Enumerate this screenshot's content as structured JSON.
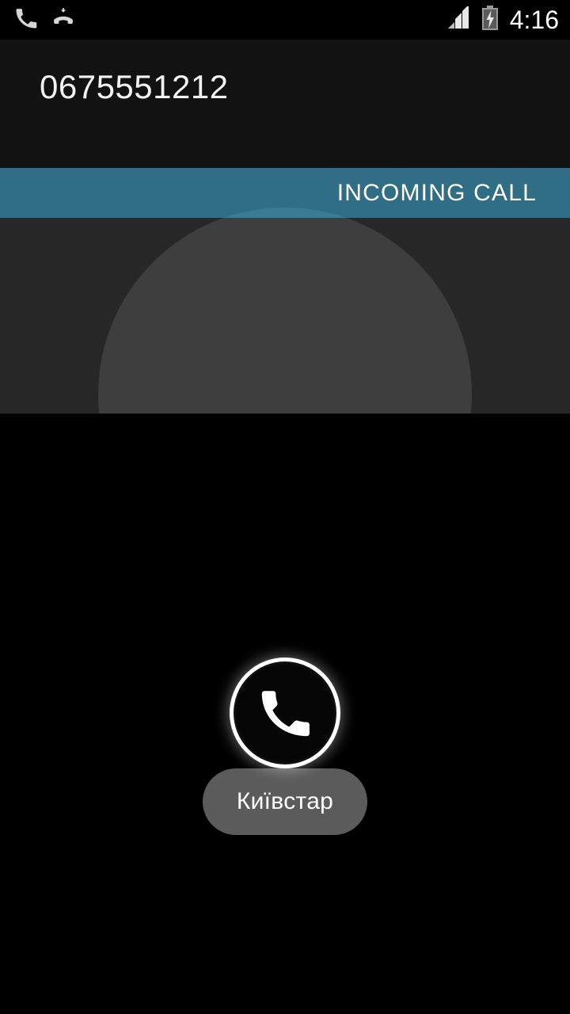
{
  "status_bar": {
    "icons_left": [
      {
        "name": "call-active-icon",
        "label": "phone-handset"
      },
      {
        "name": "missed-call-icon",
        "label": "missed-call-handset"
      }
    ],
    "signal": {
      "name": "signal-bars-icon",
      "bars_total": 4,
      "bars_filled": 2
    },
    "battery": {
      "name": "battery-charging-icon",
      "charging": true
    },
    "time": "4:16"
  },
  "caller": {
    "number": "0675551212"
  },
  "call_status": {
    "label": "INCOMING CALL",
    "strip_color": "#2f6e84",
    "strip_highlight_color": "#3a7c94"
  },
  "avatar": {
    "name": "contact-photo-placeholder",
    "fill_color": "#3e3e3e",
    "backdrop_color": "#272727"
  },
  "answer_control": {
    "name": "answer-call-button",
    "icon": "phone-handset-icon",
    "ring_color": "#ffffff"
  },
  "carrier": {
    "label": "Київстар",
    "pill_color": "#5b5b5b",
    "text_color": "#ffffff"
  },
  "theme": {
    "background": "#000000",
    "header_background": "#121212",
    "accent": "#2f6e84"
  }
}
